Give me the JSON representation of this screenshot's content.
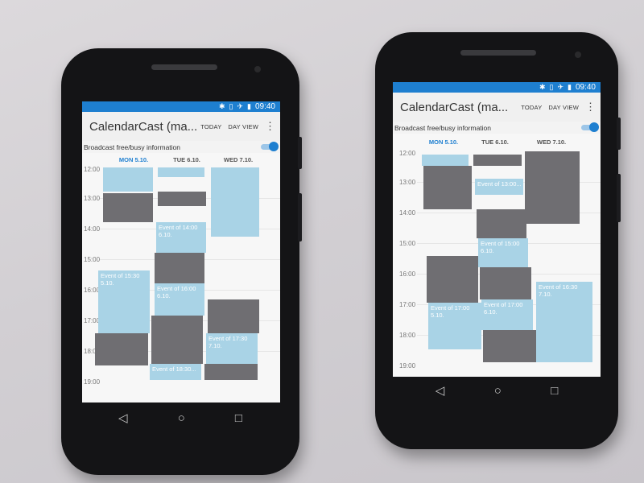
{
  "phones": [
    {
      "status_time": "09:40",
      "status_icons": [
        "bluetooth-icon",
        "vibrate-icon",
        "airplane-icon",
        "battery-icon"
      ],
      "title": "CalendarCast (ma...",
      "actions": [
        "TODAY",
        "DAY VIEW"
      ],
      "broadcast_label": "Broadcast free/busy information",
      "days": [
        "MON 5.10.",
        "TUE 6.10.",
        "WED 7.10."
      ],
      "hours": [
        "12:00",
        "13:00",
        "14:00",
        "15:00",
        "16:00",
        "17:00",
        "18:00",
        "19:00"
      ],
      "event_texts": [
        "Event of 15:30\n5.10.",
        "Event of 14:00\n6.10.",
        "Event of 16:00\n6.10.",
        "Event of 18:30...",
        "Event of 17:30\n7.10."
      ]
    },
    {
      "status_time": "09:40",
      "status_icons": [
        "bluetooth-icon",
        "vibrate-icon",
        "airplane-icon",
        "battery-icon"
      ],
      "title": "CalendarCast (ma...",
      "actions": [
        "TODAY",
        "DAY VIEW"
      ],
      "broadcast_label": "Broadcast free/busy information",
      "days": [
        "MON 5.10.",
        "TUE 6.10.",
        "WED 7.10."
      ],
      "hours": [
        "12:00",
        "13:00",
        "14:00",
        "15:00",
        "16:00",
        "17:00",
        "18:00",
        "19:00"
      ],
      "event_texts": [
        "Event of 17:00\n5.10.",
        "Event of 13:00...",
        "Event of 15:00\n6.10.",
        "Event of 17:00\n6.10.",
        "Event of 16:30\n7.10."
      ]
    }
  ],
  "colors": {
    "statusbar": "#1e7fd0",
    "today": "#1e7fd0",
    "busy": "#6f6e72",
    "free": "#a9d3e6",
    "frame": "#141416"
  },
  "nav_icons": [
    "back-icon",
    "home-icon",
    "recents-icon"
  ]
}
